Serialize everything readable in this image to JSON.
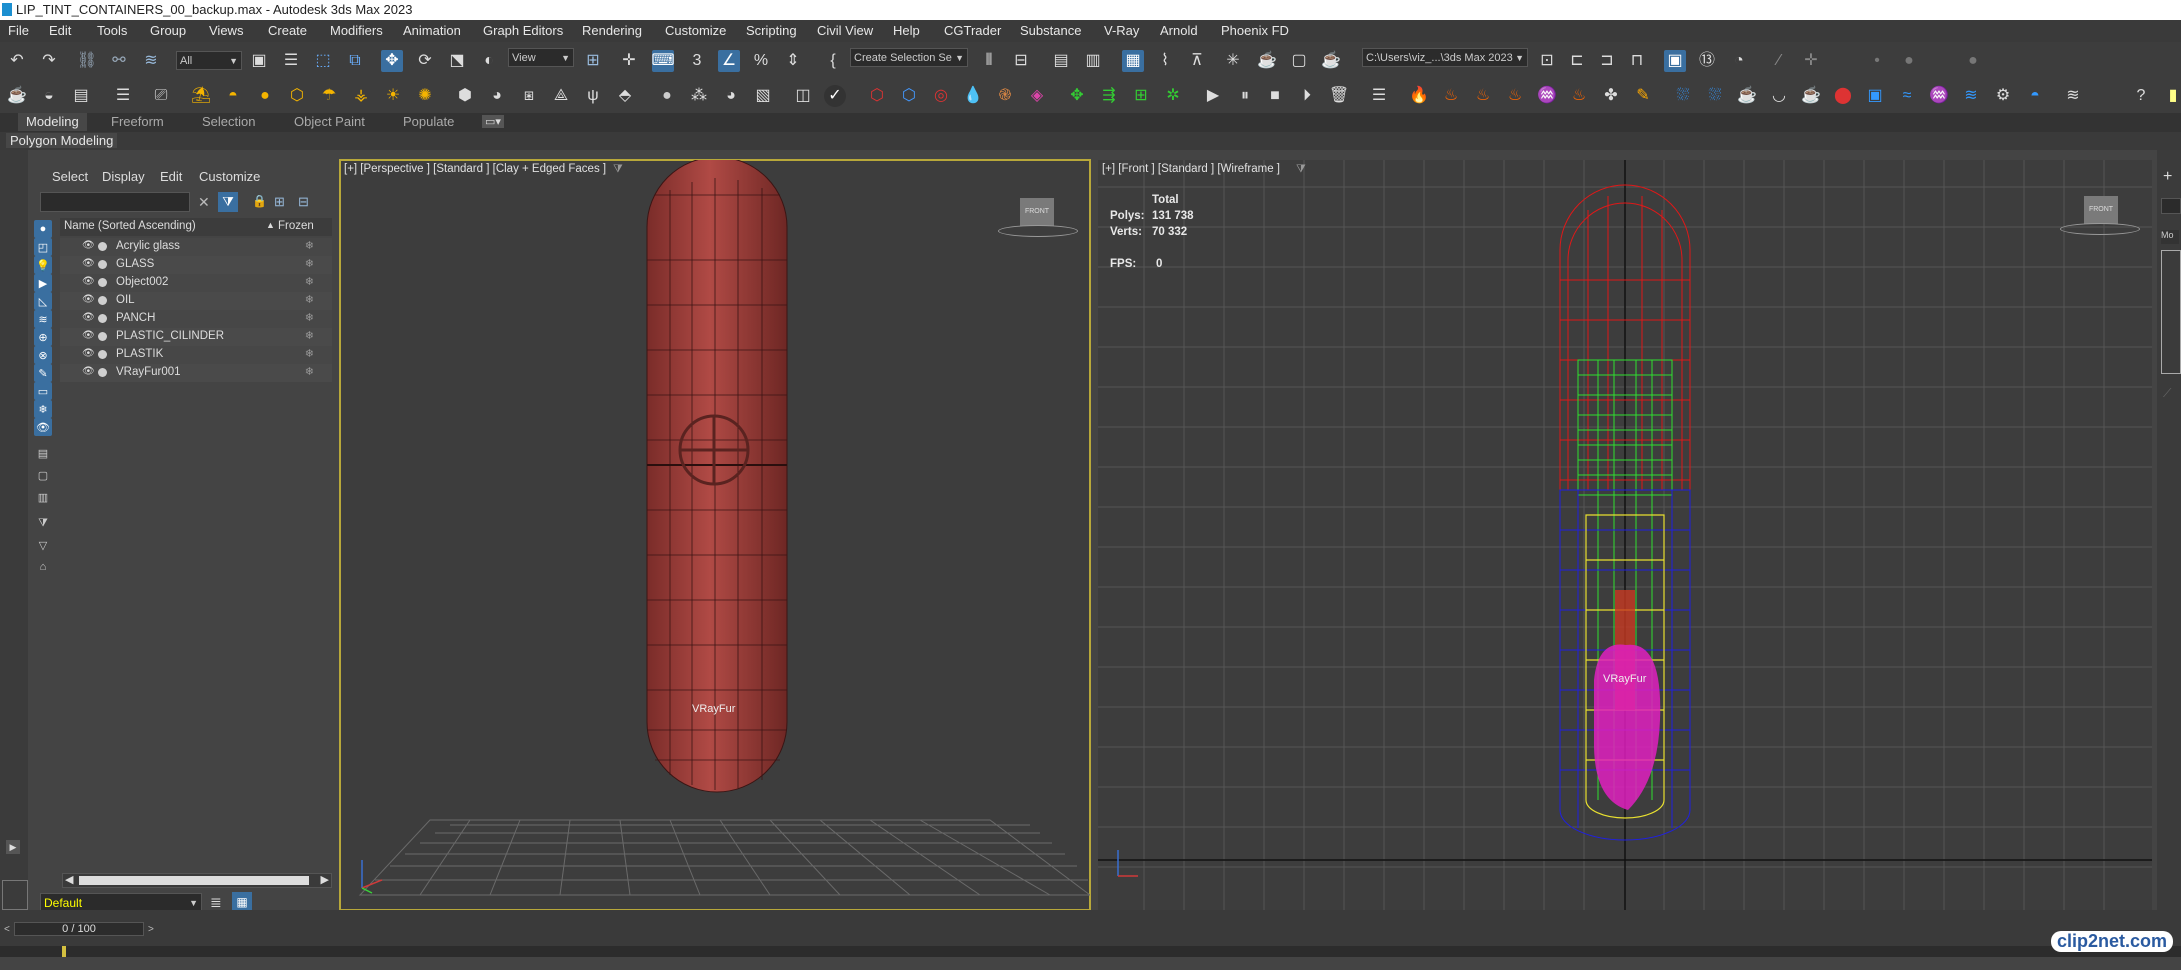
{
  "window": {
    "title": "LIP_TINT_CONTAINERS_00_backup.max - Autodesk 3ds Max 2023"
  },
  "menu": [
    "File",
    "Edit",
    "Tools",
    "Group",
    "Views",
    "Create",
    "Modifiers",
    "Animation",
    "Graph Editors",
    "Rendering",
    "Customize",
    "Scripting",
    "Civil View",
    "Help",
    "CGTrader",
    "Substance",
    "V-Ray",
    "Arnold",
    "Phoenix FD"
  ],
  "toolbar": {
    "selection_filter": "All",
    "ref_coord": "View",
    "named_selection": "Create Selection Se",
    "project_path": "C:\\Users\\viz_...\\3ds Max 2023"
  },
  "ribbon": {
    "tabs": [
      "Modeling",
      "Freeform",
      "Selection",
      "Object Paint",
      "Populate"
    ],
    "active_tab": "Modeling",
    "sub_label": "Polygon Modeling"
  },
  "scene_explorer": {
    "menu": [
      "Select",
      "Display",
      "Edit",
      "Customize"
    ],
    "column_name": "Name (Sorted Ascending)",
    "column_frozen": "Frozen",
    "items": [
      "Acrylic glass",
      "GLASS",
      "Object002",
      "OIL",
      "PANCH",
      "PLASTIC_CILINDER",
      "PLASTIK",
      "VRayFur001"
    ],
    "layer": "Default"
  },
  "viewport_left": {
    "label": "[+] [Perspective ] [Standard ] [Clay + Edged Faces ]",
    "object_label": "VRayFur",
    "viewcube_label": "FRONT"
  },
  "viewport_right": {
    "label": "[+] [Front ] [Standard ] [Wireframe ]",
    "stats_total": "Total",
    "polys_label": "Polys:",
    "polys_value": "131 738",
    "verts_label": "Verts:",
    "verts_value": "70 332",
    "fps_label": "FPS:",
    "fps_value": "0",
    "object_label": "VRayFur",
    "viewcube_label": "FRONT"
  },
  "timeline": {
    "frame": "0 / 100"
  },
  "watermark": "clip2net.com",
  "colors": {
    "accent_blue": "#3a6fa0",
    "active_border": "#b8a83a",
    "object_red": "#a8433f"
  }
}
